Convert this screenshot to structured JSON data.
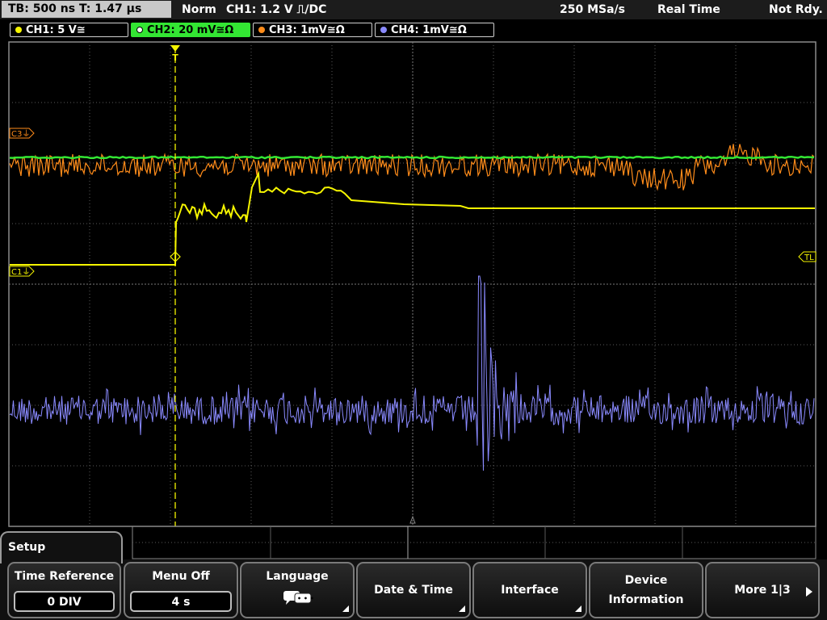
{
  "status_bar": {
    "timebase": "TB: 500 ns   T: 1.47 µs",
    "trigger_mode": "Norm",
    "trigger_info": "CH1: 1.2 V ⎍/DC",
    "sample_rate": "250 MSa/s",
    "acq_mode": "Real Time",
    "state": "Not Rdy."
  },
  "channels": [
    {
      "label": "CH1: 5 V≅",
      "color": "#f5f500"
    },
    {
      "label": "CH2: 20 mV≅Ω",
      "color": "#33e633"
    },
    {
      "label": "CH3: 1mV≅Ω",
      "color": "#ff8c1a"
    },
    {
      "label": "CH4: 1mV≅Ω",
      "color": "#8a8aff"
    }
  ],
  "markers": {
    "c3": "C3⏚",
    "c1": "C1⏚",
    "tl": "TL",
    "trigger": "T"
  },
  "setup_menu": {
    "title": "Setup",
    "keys": [
      {
        "label": "Time Reference",
        "value": "0 DIV"
      },
      {
        "label": "Menu Off",
        "value": "4 s"
      },
      {
        "label": "Language",
        "icon": "speech-bubbles-icon"
      },
      {
        "label": "Date & Time"
      },
      {
        "label": "Interface"
      },
      {
        "label_line1": "Device",
        "label_line2": "Information"
      },
      {
        "label": "More 1|3"
      }
    ]
  }
}
